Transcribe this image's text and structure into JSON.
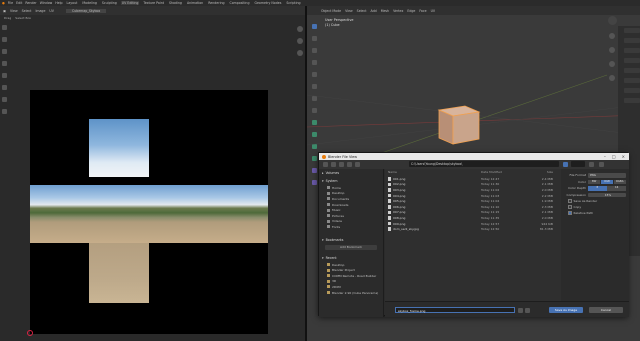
{
  "menubar": {
    "items": [
      "File",
      "Edit",
      "Render",
      "Window",
      "Help"
    ],
    "tabs": [
      "Layout",
      "Modeling",
      "Sculpting",
      "UV Editing",
      "Texture Paint",
      "Shading",
      "Animation",
      "Rendering",
      "Compositing",
      "Geometry Nodes",
      "Scripting"
    ],
    "active_tab": "UV Editing"
  },
  "uv_editor": {
    "header_items": [
      "View",
      "Select",
      "Image",
      "UV"
    ],
    "image_name": "Cubemap_Skybox",
    "sub_items": [
      "Drag",
      "Select Box"
    ]
  },
  "viewport": {
    "header_items": [
      "Object Mode",
      "View",
      "Select",
      "Add",
      "Mesh",
      "Vertex",
      "Edge",
      "Face",
      "UV"
    ],
    "label_line1": "User Perspective",
    "label_line2": "(1) Cube"
  },
  "file_browser": {
    "title": "Blender File View",
    "path": "C:\\Users\\Young\\Desktop\\skybox\\",
    "sections": {
      "system": "System",
      "volumes": "Volumes",
      "bookmarks": "Bookmarks",
      "recent": "Recent"
    },
    "system_items": [
      "Home",
      "Desktop",
      "Documents",
      "Downloads",
      "Music",
      "Pictures",
      "Videos",
      "Fonts"
    ],
    "add_bookmark": "Add Bookmark",
    "recent_items": [
      "Desktop",
      "Blender Project",
      "COMM Remote - Road Builder",
      "3D",
      "2D0M",
      "Blender 2.90 (Cube Panorama)"
    ],
    "columns": {
      "name": "Name",
      "date": "Date Modified",
      "size": "Size"
    },
    "files": [
      {
        "name": "001.png",
        "date": "Today 12:47",
        "size": "2.4 MiB"
      },
      {
        "name": "002.png",
        "date": "Today 11:30",
        "size": "2.1 MiB"
      },
      {
        "name": "003.png",
        "date": "Today 11:02",
        "size": "2.0 MiB"
      },
      {
        "name": "004.png",
        "date": "Today 11:03",
        "size": "2.2 MiB"
      },
      {
        "name": "005.png",
        "date": "Today 11:04",
        "size": "1.9 MiB"
      },
      {
        "name": "006.png",
        "date": "Today 11:10",
        "size": "2.3 MiB"
      },
      {
        "name": "007.png",
        "date": "Today 11:15",
        "size": "2.1 MiB"
      },
      {
        "name": "008.png",
        "date": "Today 11:35",
        "size": "2.0 MiB"
      },
      {
        "name": "009.png",
        "date": "Today 12:57",
        "size": "944 KiB"
      },
      {
        "name": "dom_sedi_sky.jpg",
        "date": "Today 12:50",
        "size": "81.3 MiB"
      }
    ],
    "options": {
      "file_format_label": "File Format",
      "file_format": "PNG",
      "color_label": "Color",
      "color_options": [
        "BW",
        "RGB",
        "RGBA"
      ],
      "color_selected": "RGB",
      "depth_label": "Color Depth",
      "depth_options": [
        "8",
        "16"
      ],
      "depth_selected": "8",
      "compression_label": "Compression",
      "compression": "15%",
      "save_as_render": "Save As Render",
      "copy": "Copy",
      "relative_path": "Relative Path"
    },
    "filename": "skybox_frame.png",
    "save_button": "Save As Image",
    "cancel_button": "Cancel"
  },
  "colors": {
    "accent": "#4772b3",
    "cube": "#c9a48b"
  }
}
